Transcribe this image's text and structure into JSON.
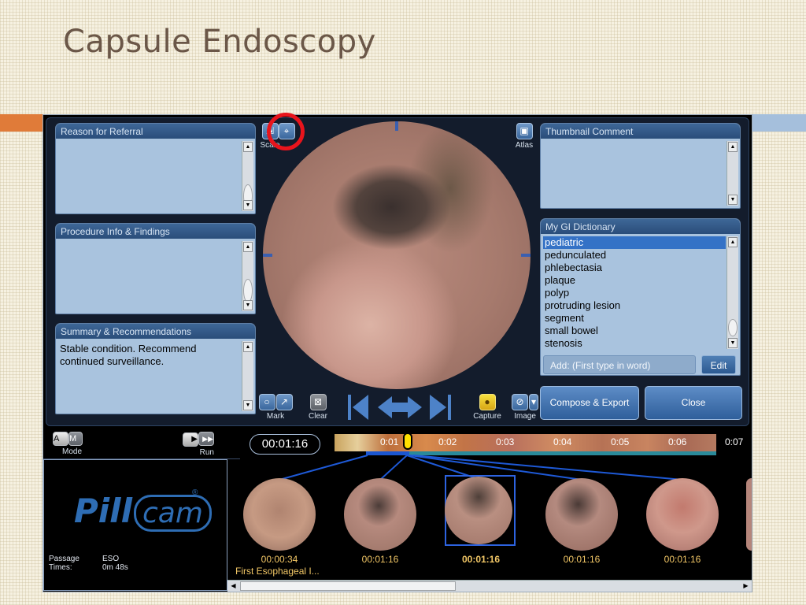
{
  "slide": {
    "title": "Capsule Endoscopy"
  },
  "panels": {
    "referral": {
      "title": "Reason for Referral",
      "body": ""
    },
    "procedure": {
      "title": "Procedure Info & Findings",
      "body": ""
    },
    "summary": {
      "title": "Summary & Recommendations",
      "body": "Stable condition. Recommend continued surveillance."
    },
    "thumbnail_comment": {
      "title": "Thumbnail Comment",
      "body": ""
    }
  },
  "dictionary": {
    "title": "My GI Dictionary",
    "items": [
      "pediatric",
      "pedunculated",
      "phlebectasia",
      "plaque",
      "polyp",
      "protruding lesion",
      "segment",
      "small bowel",
      "stenosis"
    ],
    "selected_index": 0,
    "add_placeholder": "Add: (First type in word)",
    "edit_label": "Edit"
  },
  "viewer_tools": {
    "scale_label": "Scale",
    "atlas_label": "Atlas",
    "mark_label": "Mark",
    "clear_label": "Clear",
    "capture_label": "Capture",
    "image_label": "Image"
  },
  "actions": {
    "compose_export": "Compose & Export",
    "close": "Close"
  },
  "controls": {
    "mode_label": "Mode",
    "run_label": "Run",
    "mode_a": "A",
    "mode_m": "M"
  },
  "timeline": {
    "current_time": "00:01:16",
    "labels": [
      "0:01",
      "0:02",
      "0:03",
      "0:04",
      "0:05",
      "0:06",
      "0:07"
    ]
  },
  "thumbnails": [
    {
      "time": "00:00:34",
      "comment": "First Esophageal I..."
    },
    {
      "time": "00:01:16"
    },
    {
      "time": "00:01:16",
      "active": true
    },
    {
      "time": "00:01:16"
    },
    {
      "time": "00:01:16"
    }
  ],
  "logo": {
    "pill": "Pill",
    "cam": "cam",
    "reg": "®"
  },
  "passage": {
    "label_passage": "Passage",
    "label_times": "Times:",
    "value_passage": "ESO",
    "value_times": "0m 48s"
  },
  "colors": {
    "accent_orange": "#e07b39",
    "accent_blue": "#a5bfdc",
    "panel_bg": "#a9c3de",
    "time_text": "#f2c766",
    "highlight_red": "#e8141c"
  }
}
